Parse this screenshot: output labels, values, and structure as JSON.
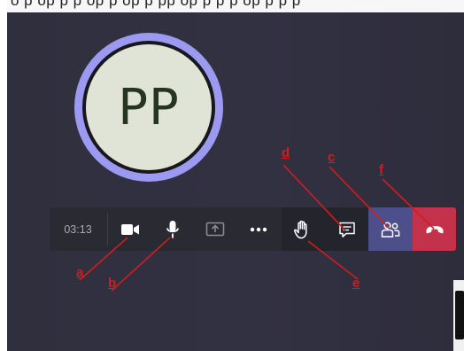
{
  "top_strip": {
    "text": "o    p   op   p     p      op   p      op   p  pp   op   p    p   p    op   p      p   p"
  },
  "avatar": {
    "initials": "PP"
  },
  "call_toolbar": {
    "timer": "03:13",
    "buttons": [
      {
        "name": "camera",
        "icon": "video-camera-icon"
      },
      {
        "name": "microphone",
        "icon": "microphone-icon"
      },
      {
        "name": "share",
        "icon": "share-screen-icon"
      },
      {
        "name": "more",
        "icon": "more-options-icon"
      },
      {
        "name": "raise-hand",
        "icon": "raise-hand-icon"
      },
      {
        "name": "chat",
        "icon": "chat-icon"
      },
      {
        "name": "participants",
        "icon": "people-icon"
      },
      {
        "name": "hang-up",
        "icon": "hang-up-icon"
      }
    ]
  },
  "annotations": {
    "a": "a",
    "b": "b",
    "c": "c",
    "d": "d",
    "e": "e",
    "f": "f"
  },
  "colors": {
    "annotation": "#d01e1e",
    "hangup": "#c4314b",
    "people_active": "#4d4f8a",
    "avatar_ring": "#9c9af0",
    "avatar_fill": "#dfe4d7"
  }
}
